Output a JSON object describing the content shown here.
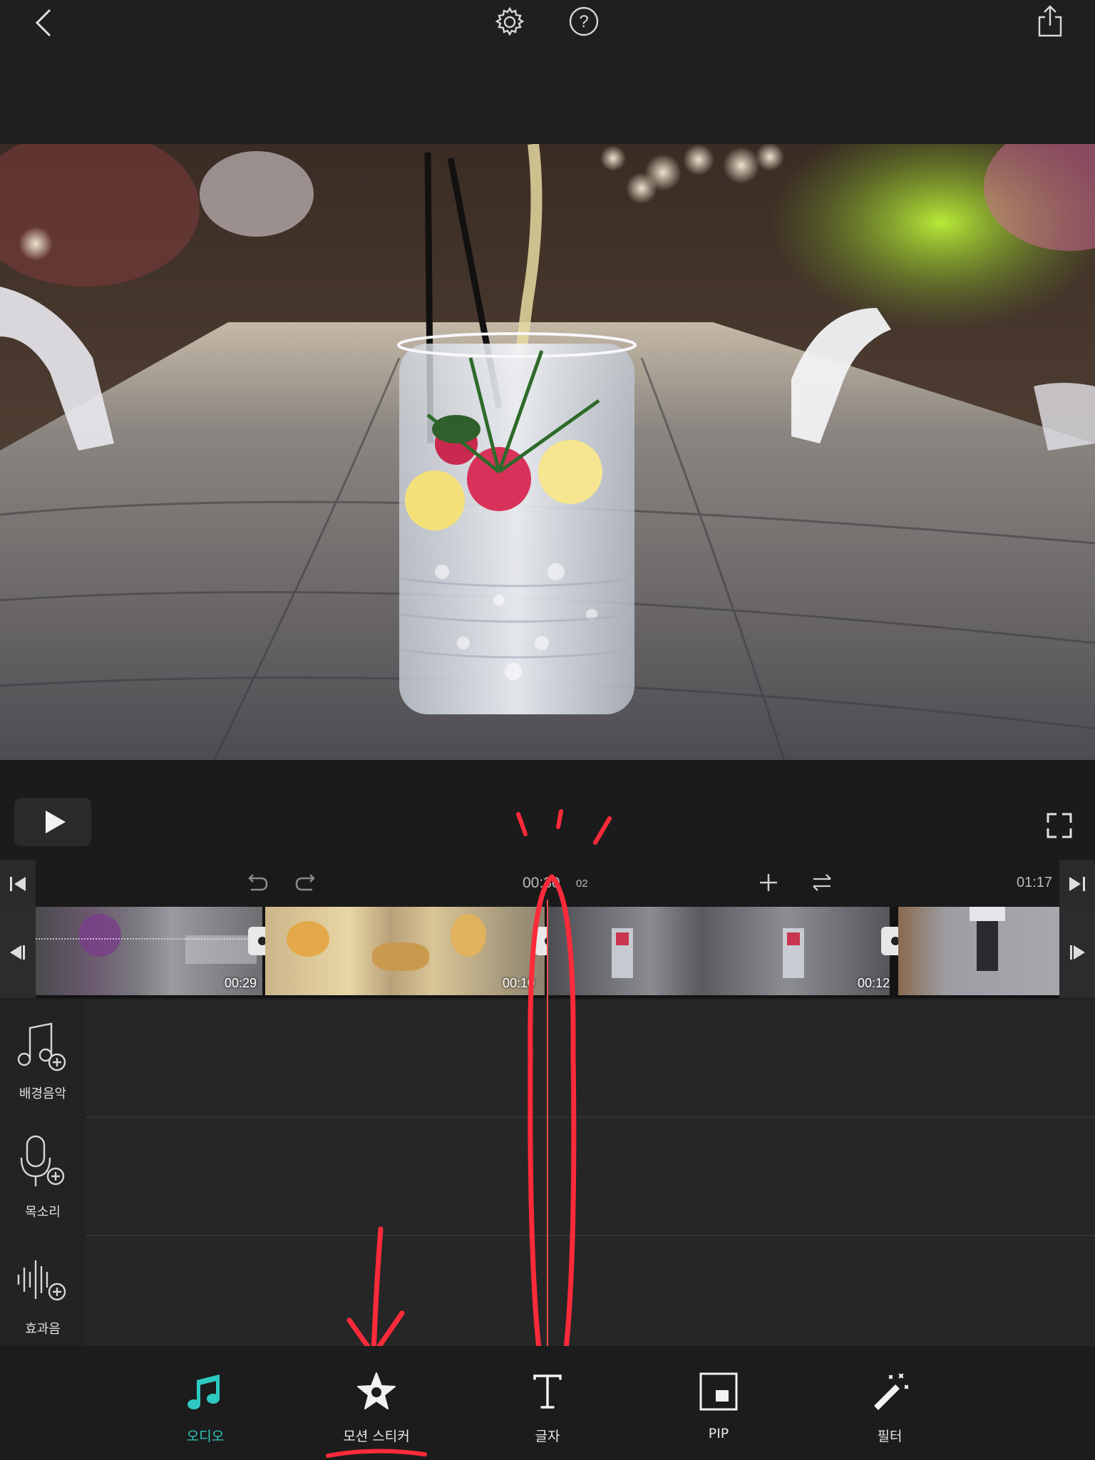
{
  "timeline": {
    "current_time": "00:30",
    "current_frame": "02",
    "total_time": "01:17"
  },
  "clips": [
    {
      "duration": "00:29"
    },
    {
      "duration": "00:10"
    },
    {
      "duration": "00:12"
    }
  ],
  "audio_tracks": [
    {
      "label": "배경음악",
      "icon": "music-add-icon"
    },
    {
      "label": "목소리",
      "icon": "microphone-add-icon"
    },
    {
      "label": "효과음",
      "icon": "sound-effect-add-icon"
    }
  ],
  "tabs": [
    {
      "label": "오디오",
      "icon": "music-note-icon",
      "active": true
    },
    {
      "label": "모션 스티커",
      "icon": "star-icon",
      "active": false
    },
    {
      "label": "글자",
      "icon": "text-icon",
      "active": false
    },
    {
      "label": "PIP",
      "icon": "pip-icon",
      "active": false
    },
    {
      "label": "필터",
      "icon": "magic-wand-icon",
      "active": false
    }
  ],
  "colors": {
    "accent": "#2ec9c0",
    "playhead": "#ff4d4d",
    "annotation": "#ff2a3a"
  }
}
